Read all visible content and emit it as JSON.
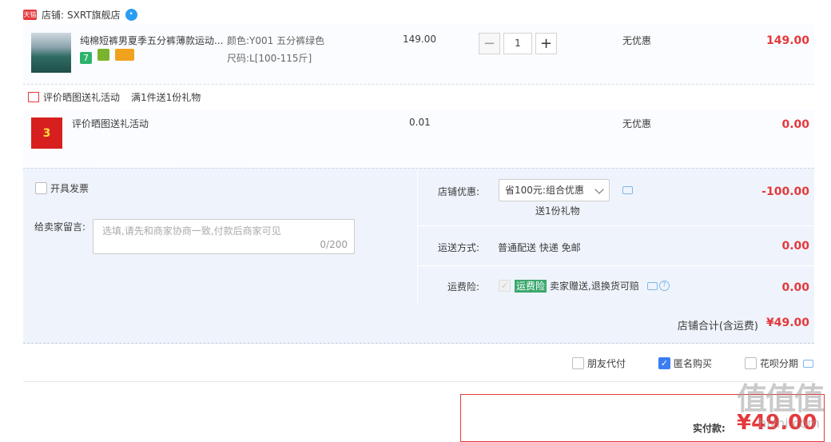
{
  "shop": {
    "tmall_badge": "天猫",
    "label": "店铺:",
    "name": "SXRT旗舰店"
  },
  "item1": {
    "title": "纯棉短裤男夏季五分裤薄款运动...",
    "color": "颜色:Y001 五分裤绿色",
    "size": "尺码:L[100-115斤]",
    "badge1": "7",
    "price": "149.00",
    "quantity": "1",
    "discount": "无优惠",
    "subtotal": "149.00"
  },
  "gift": {
    "title": "评价晒图送礼活动",
    "desc": "满1件送1份礼物"
  },
  "item2": {
    "thumb_text": "3",
    "title": "评价晒图送礼活动",
    "price": "0.01",
    "discount": "无优惠",
    "subtotal": "0.00"
  },
  "invoice": {
    "label": "开具发票"
  },
  "message": {
    "label": "给卖家留言:",
    "placeholder": "选填,请先和商家协商一致,付款后商家可见",
    "count": "0/200"
  },
  "shop_discount": {
    "label": "店铺优惠:",
    "selected": "省100元:组合优惠",
    "note": "送1份礼物",
    "amount": "-100.00"
  },
  "shipping": {
    "label": "运送方式:",
    "method": "普通配送 快递 免邮",
    "amount": "0.00"
  },
  "insurance": {
    "label": "运费险:",
    "tag": "运费险",
    "desc": "卖家赠送,退换货可赔",
    "amount": "0.00"
  },
  "shop_total": {
    "label": "店铺合计(含运费)",
    "amount": "¥49.00"
  },
  "options": {
    "friend_pay": "朋友代付",
    "anonymous": "匿名购买",
    "huabei": "花呗分期"
  },
  "pay": {
    "label": "实付款:",
    "amount": "¥49.00"
  },
  "watermark": {
    "logo": "值值值",
    "site": "hizhi.com"
  },
  "colors": {
    "accent": "#e4393c",
    "panel": "#eff4fc",
    "checkbox": "#3b7cf2",
    "insurance_tag": "#3aa76d"
  }
}
